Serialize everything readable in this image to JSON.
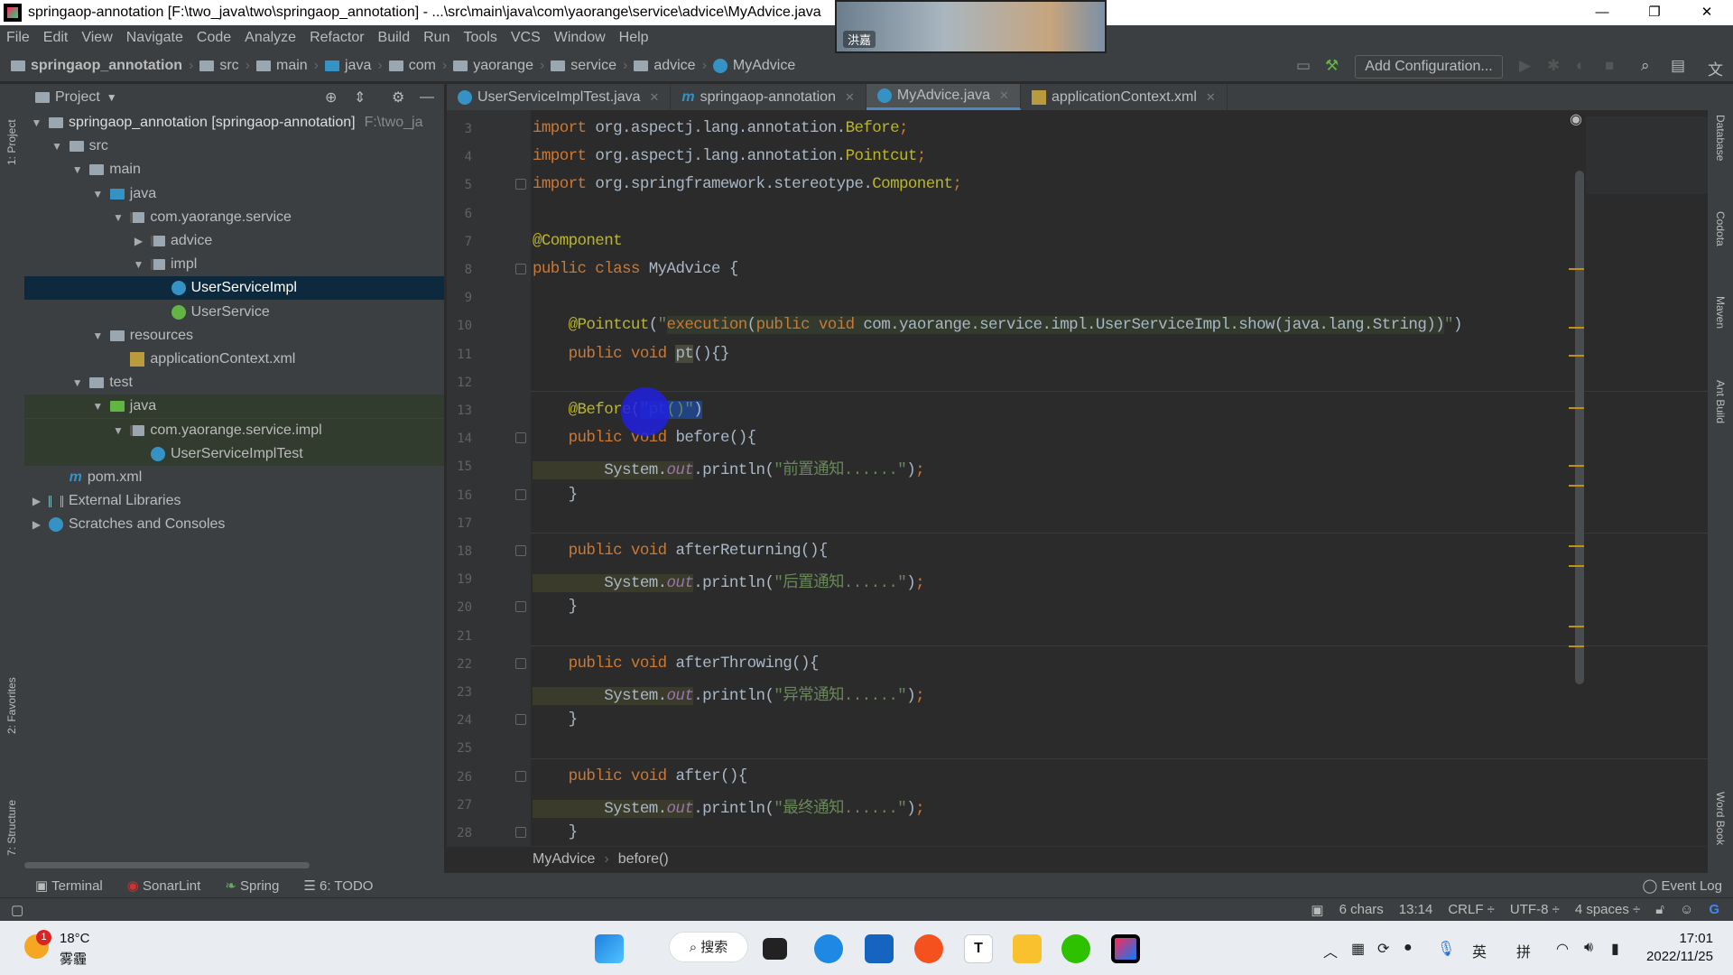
{
  "window": {
    "title": "springaop-annotation [F:\\two_java\\two\\springaop_annotation] - ...\\src\\main\\java\\com\\yaorange\\service\\advice\\MyAdvice.java",
    "controls": [
      "—",
      "❐",
      "✕"
    ]
  },
  "webcam": {
    "name": "洪嘉"
  },
  "menu": [
    "File",
    "Edit",
    "View",
    "Navigate",
    "Code",
    "Analyze",
    "Refactor",
    "Build",
    "Run",
    "Tools",
    "VCS",
    "Window",
    "Help"
  ],
  "navbar": {
    "crumbs": [
      "springaop_annotation",
      "src",
      "main",
      "java",
      "com",
      "yaorange",
      "service",
      "advice",
      "MyAdvice"
    ],
    "add_configuration": "Add Configuration..."
  },
  "left_strip": {
    "project": "1: Project",
    "favorites": "2: Favorites",
    "structure": "7: Structure"
  },
  "right_strip": [
    "Database",
    "Codota",
    "Maven",
    "Ant Build",
    "Word Book"
  ],
  "project_panel": {
    "title": "Project",
    "tree": [
      {
        "label": "springaop_annotation [springaop-annotation]",
        "extra": "F:\\two_ja",
        "depth": 0,
        "arrow": "▼",
        "icon": "folder"
      },
      {
        "label": "src",
        "depth": 1,
        "arrow": "▼",
        "icon": "folder"
      },
      {
        "label": "main",
        "depth": 2,
        "arrow": "▼",
        "icon": "folder"
      },
      {
        "label": "java",
        "depth": 3,
        "arrow": "▼",
        "icon": "folder-blue"
      },
      {
        "label": "com.yaorange.service",
        "depth": 4,
        "arrow": "▼",
        "icon": "package"
      },
      {
        "label": "advice",
        "depth": 5,
        "arrow": "▶",
        "icon": "package"
      },
      {
        "label": "impl",
        "depth": 5,
        "arrow": "▼",
        "icon": "package"
      },
      {
        "label": "UserServiceImpl",
        "depth": 6,
        "arrow": "",
        "icon": "class",
        "selected": true
      },
      {
        "label": "UserService",
        "depth": 6,
        "arrow": "",
        "icon": "interface"
      },
      {
        "label": "resources",
        "depth": 3,
        "arrow": "▼",
        "icon": "folder"
      },
      {
        "label": "applicationContext.xml",
        "depth": 4,
        "arrow": "",
        "icon": "xml"
      },
      {
        "label": "test",
        "depth": 2,
        "arrow": "▼",
        "icon": "folder"
      },
      {
        "label": "java",
        "depth": 3,
        "arrow": "▼",
        "icon": "folder-green",
        "test": true
      },
      {
        "label": "com.yaorange.service.impl",
        "depth": 4,
        "arrow": "▼",
        "icon": "package",
        "test": true
      },
      {
        "label": "UserServiceImplTest",
        "depth": 5,
        "arrow": "",
        "icon": "class",
        "test": true
      },
      {
        "label": "pom.xml",
        "depth": 1,
        "arrow": "",
        "icon": "maven"
      },
      {
        "label": "External Libraries",
        "depth": 0,
        "arrow": "▶",
        "icon": "library"
      },
      {
        "label": "Scratches and Consoles",
        "depth": 0,
        "arrow": "▶",
        "icon": "scratch"
      }
    ]
  },
  "tabs": [
    {
      "label": "UserServiceImplTest.java",
      "icon": "class"
    },
    {
      "label": "springaop-annotation",
      "icon": "maven"
    },
    {
      "label": "MyAdvice.java",
      "icon": "class",
      "active": true
    },
    {
      "label": "applicationContext.xml",
      "icon": "xml"
    }
  ],
  "editor": {
    "lines": [
      {
        "n": "3",
        "t": [
          [
            "kw",
            "import "
          ],
          [
            "pl",
            "org.aspectj.lang.annotation."
          ],
          [
            "an",
            "Before"
          ],
          [
            "kw",
            ";"
          ]
        ]
      },
      {
        "n": "4",
        "t": [
          [
            "kw",
            "import "
          ],
          [
            "pl",
            "org.aspectj.lang.annotation."
          ],
          [
            "an",
            "Pointcut"
          ],
          [
            "kw",
            ";"
          ]
        ]
      },
      {
        "n": "5",
        "t": [
          [
            "kw",
            "import "
          ],
          [
            "pl",
            "org.springframework.stereotype."
          ],
          [
            "an",
            "Component"
          ],
          [
            "kw",
            ";"
          ]
        ]
      },
      {
        "n": "6",
        "t": []
      },
      {
        "n": "7",
        "t": [
          [
            "an",
            "@Component"
          ]
        ]
      },
      {
        "n": "8",
        "t": [
          [
            "kw",
            "public class "
          ],
          [
            "pl",
            "MyAdvice {"
          ]
        ]
      },
      {
        "n": "9",
        "t": []
      },
      {
        "n": "10",
        "t": [
          [
            "an",
            "    @Pointcut"
          ],
          [
            "pl",
            "("
          ],
          [
            "st",
            "\""
          ],
          [
            "kw inj",
            "execution"
          ],
          [
            "pl inj",
            "("
          ],
          [
            "kw inj",
            "public void "
          ],
          [
            "pl inj",
            "com.yaorange.service.impl.UserServiceImpl.show(java.lang.String))"
          ],
          [
            "st",
            "\""
          ],
          [
            "pl",
            ")"
          ]
        ]
      },
      {
        "n": "11",
        "t": [
          [
            "kw",
            "    public void "
          ],
          [
            "pl hl",
            "pt"
          ],
          [
            "pl",
            "(){}"
          ]
        ]
      },
      {
        "n": "12",
        "t": []
      },
      {
        "n": "13",
        "t": [
          [
            "an",
            "    @Before"
          ],
          [
            "pl",
            "("
          ],
          [
            "st sel2",
            "\"pt()\""
          ],
          [
            "pl sel2",
            ")"
          ]
        ]
      },
      {
        "n": "14",
        "t": [
          [
            "kw",
            "    public void "
          ],
          [
            "pl",
            "before(){"
          ]
        ]
      },
      {
        "n": "15",
        "t": [
          [
            "pl sys",
            "        System."
          ],
          [
            "sf sys",
            "out"
          ],
          [
            "pl",
            ".println("
          ],
          [
            "st",
            "\"前置通知......\""
          ],
          [
            "pl",
            ")"
          ],
          [
            "kw",
            ";"
          ]
        ]
      },
      {
        "n": "16",
        "t": [
          [
            "pl",
            "    }"
          ]
        ]
      },
      {
        "n": "17",
        "t": []
      },
      {
        "n": "18",
        "t": [
          [
            "kw",
            "    public void "
          ],
          [
            "pl",
            "afterReturning(){"
          ]
        ]
      },
      {
        "n": "19",
        "t": [
          [
            "pl sys",
            "        System."
          ],
          [
            "sf sys",
            "out"
          ],
          [
            "pl",
            ".println("
          ],
          [
            "st",
            "\"后置通知......\""
          ],
          [
            "pl",
            ")"
          ],
          [
            "kw",
            ";"
          ]
        ]
      },
      {
        "n": "20",
        "t": [
          [
            "pl",
            "    }"
          ]
        ]
      },
      {
        "n": "21",
        "t": []
      },
      {
        "n": "22",
        "t": [
          [
            "kw",
            "    public void "
          ],
          [
            "pl",
            "afterThrowing(){"
          ]
        ]
      },
      {
        "n": "23",
        "t": [
          [
            "pl sys",
            "        System."
          ],
          [
            "sf sys",
            "out"
          ],
          [
            "pl",
            ".println("
          ],
          [
            "st",
            "\"异常通知......\""
          ],
          [
            "pl",
            ")"
          ],
          [
            "kw",
            ";"
          ]
        ]
      },
      {
        "n": "24",
        "t": [
          [
            "pl",
            "    }"
          ]
        ]
      },
      {
        "n": "25",
        "t": []
      },
      {
        "n": "26",
        "t": [
          [
            "kw",
            "    public void "
          ],
          [
            "pl",
            "after(){"
          ]
        ]
      },
      {
        "n": "27",
        "t": [
          [
            "pl sys",
            "        System."
          ],
          [
            "sf sys",
            "out"
          ],
          [
            "pl",
            ".println("
          ],
          [
            "st",
            "\"最终通知......\""
          ],
          [
            "pl",
            ")"
          ],
          [
            "kw",
            ";"
          ]
        ]
      },
      {
        "n": "28",
        "t": [
          [
            "pl",
            "    }"
          ]
        ]
      }
    ],
    "breadcrumb": [
      "MyAdvice",
      "before()"
    ]
  },
  "tool_windows": [
    "Terminal",
    "SonarLint",
    "Spring",
    "6: TODO"
  ],
  "event_log": "Event Log",
  "status": {
    "selection": "6 chars",
    "position": "13:14",
    "line_ending": "CRLF ÷",
    "encoding": "UTF-8 ÷",
    "indent": "4 spaces ÷"
  },
  "taskbar": {
    "weather_temp": "18°C",
    "weather_desc": "雾霾",
    "weather_badge": "1",
    "search": "搜索",
    "ime_lang": "英",
    "ime_mode": "拼",
    "time": "17:01",
    "date": "2022/11/25"
  },
  "colors": {
    "keyword": "#cc7832",
    "annotation": "#bbb529",
    "string": "#6a8759",
    "text": "#a9b7c6",
    "accent": "#4a88c7"
  }
}
